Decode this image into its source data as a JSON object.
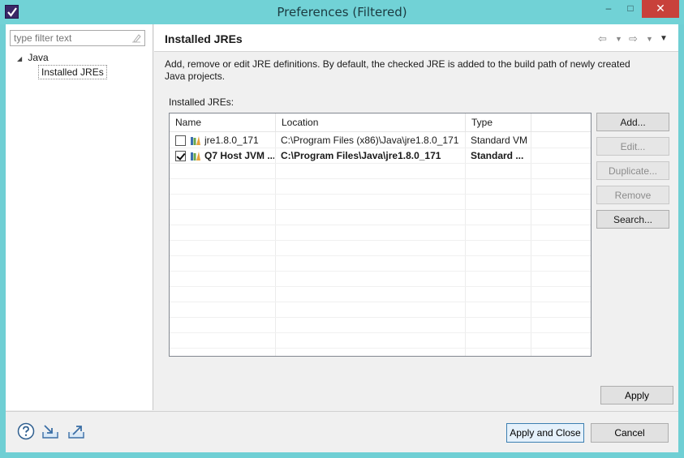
{
  "window": {
    "title": "Preferences (Filtered)",
    "minimize": "–",
    "maximize": "□",
    "close": "✕"
  },
  "sidebar": {
    "filter_placeholder": "type filter text",
    "tree": {
      "root_label": "Java",
      "child_label": "Installed JREs"
    }
  },
  "page": {
    "title": "Installed JREs",
    "description": "Add, remove or edit JRE definitions. By default, the checked JRE is added to the build path of newly created Java projects.",
    "table_label": "Installed JREs:",
    "columns": [
      "Name",
      "Location",
      "Type"
    ],
    "rows": [
      {
        "checked": false,
        "name": "jre1.8.0_171",
        "location": "C:\\Program Files (x86)\\Java\\jre1.8.0_171",
        "type": "Standard VM",
        "bold": false
      },
      {
        "checked": true,
        "name": "Q7 Host JVM ...",
        "location": "C:\\Program Files\\Java\\jre1.8.0_171",
        "type": "Standard ...",
        "bold": true
      }
    ],
    "buttons": {
      "add": "Add...",
      "edit": "Edit...",
      "duplicate": "Duplicate...",
      "remove": "Remove",
      "search": "Search...",
      "apply": "Apply"
    }
  },
  "footer": {
    "apply_close": "Apply and Close",
    "cancel": "Cancel"
  },
  "colors": {
    "titlebar": "#71d2d6",
    "close_button": "#c8413b",
    "default_button_border": "#3c7fb1"
  },
  "icons": [
    "app-logo-icon",
    "clear-filter-icon",
    "back-arrow-icon",
    "forward-arrow-icon",
    "view-menu-icon",
    "jre-library-icon",
    "help-icon",
    "import-icon",
    "export-icon"
  ]
}
